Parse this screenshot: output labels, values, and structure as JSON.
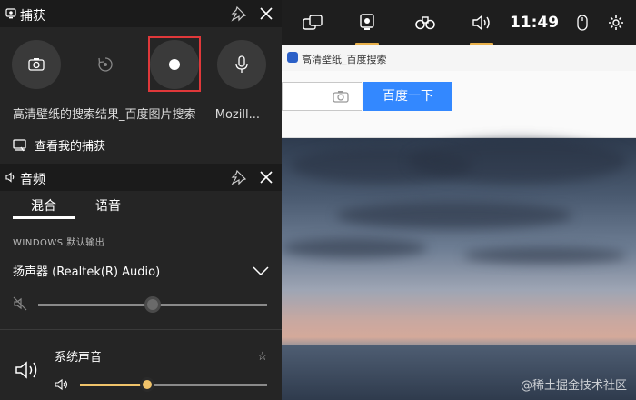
{
  "gamebar": {
    "time": "11:49",
    "items": [
      {
        "name": "widget-menu-icon",
        "active": false
      },
      {
        "name": "capture-widget-icon",
        "active": true
      },
      {
        "name": "looking-for-group-icon",
        "active": false
      },
      {
        "name": "audio-widget-icon",
        "active": true
      }
    ]
  },
  "browser": {
    "tab_title": "高清壁纸_百度搜索",
    "search_button": "百度一下"
  },
  "capture": {
    "header": "捕获",
    "window_title": "高清壁纸的搜索结果_百度图片搜索 — Mozill...",
    "gallery_link": "查看我的捕获"
  },
  "audio": {
    "header": "音频",
    "tabs": [
      "混合",
      "语音"
    ],
    "section_label": "WINDOWS 默认输出",
    "device": "扬声器 (Realtek(R) Audio)",
    "master_volume_fraction": 0.5,
    "app": {
      "name": "系统声音",
      "volume_fraction": 0.36
    }
  },
  "watermark": "@稀土掘金技术社区",
  "colors": {
    "accent_yellow": "#e8b04a",
    "record_highlight": "#e0383a",
    "search_button_blue": "#3388ff"
  }
}
